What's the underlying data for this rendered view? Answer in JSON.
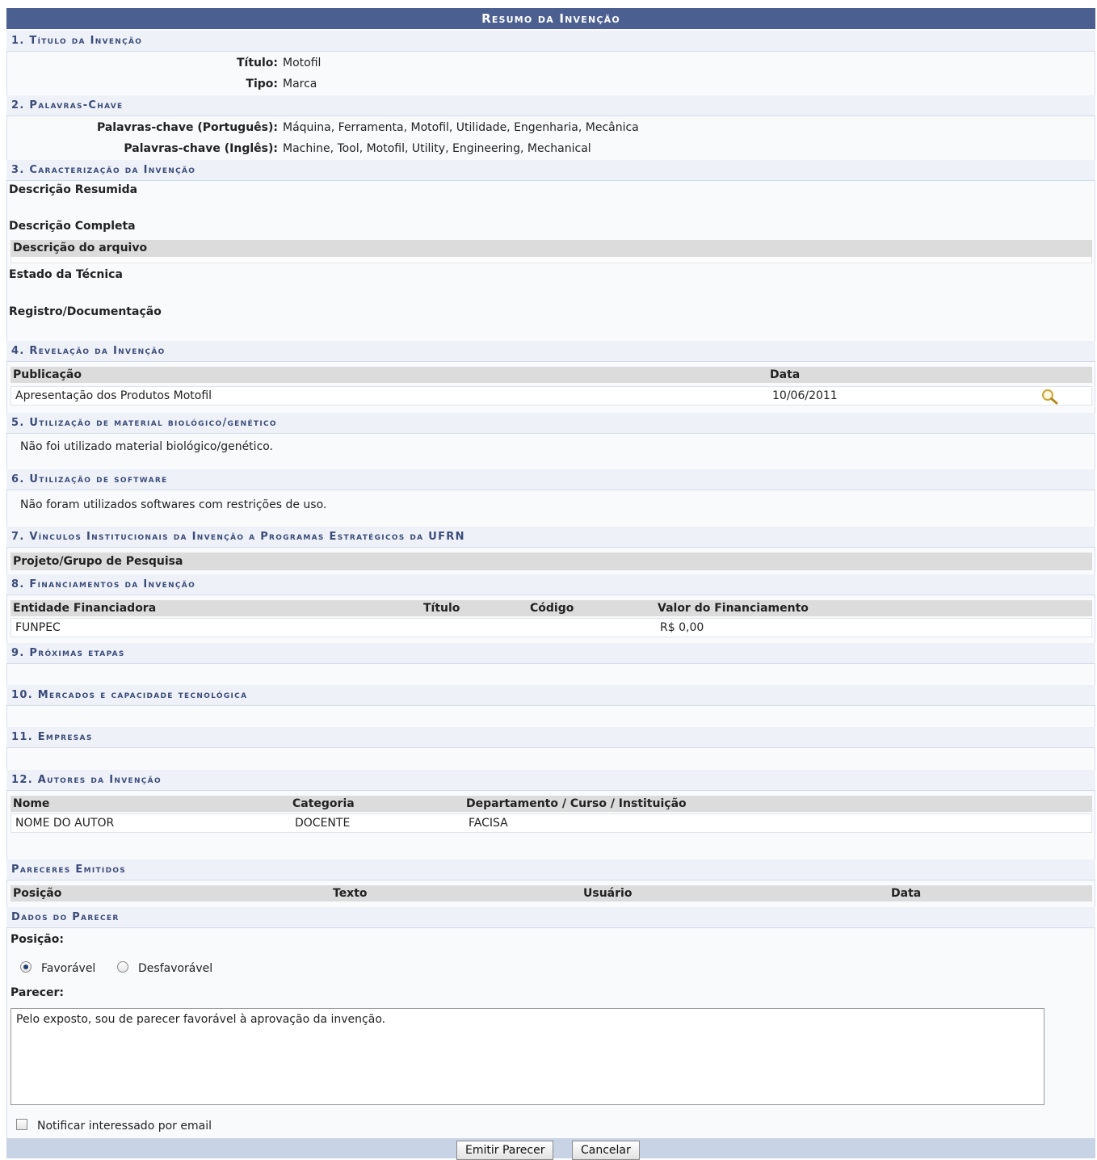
{
  "title": "Resumo da Invenção",
  "s1": {
    "header": "1. Título da Invenção",
    "titulo_label": "Título:",
    "titulo": "Motofil",
    "tipo_label": "Tipo:",
    "tipo": "Marca"
  },
  "s2": {
    "header": "2. Palavras-Chave",
    "pt_label": "Palavras-chave (Português):",
    "pt": "Máquina, Ferramenta, Motofil, Utilidade, Engenharia, Mecânica",
    "en_label": "Palavras-chave (Inglês):",
    "en": "Machine, Tool, Motofil, Utility, Engineering, Mechanical"
  },
  "s3": {
    "header": "3. Caracterização da Invenção",
    "desc_resumida": "Descrição Resumida",
    "desc_completa": "Descrição Completa",
    "desc_arquivo": "Descrição do arquivo",
    "estado_tecnica": "Estado da Técnica",
    "registro": "Registro/Documentação"
  },
  "s4": {
    "header": "4. Revelação da Invenção",
    "columns": [
      "Publicação",
      "Data"
    ],
    "rows": [
      {
        "publicacao": "Apresentação dos Produtos Motofil",
        "data": "10/06/2011",
        "action_icon": "magnifier-icon"
      }
    ]
  },
  "s5": {
    "header": "5. Utilização de material biológico/genético",
    "text": "Não foi utilizado material biológico/genético."
  },
  "s6": {
    "header": "6. Utilização de software",
    "text": "Não foram utilizados softwares com restrições de uso."
  },
  "s7": {
    "header": "7. Vínculos Institucionais da Invenção a Programas Estratégicos da UFRN",
    "subheader": "Projeto/Grupo de Pesquisa"
  },
  "s8": {
    "header": "8. Financiamentos da Invenção",
    "columns": [
      "Entidade Financiadora",
      "Título",
      "Código",
      "Valor do Financiamento"
    ],
    "rows": [
      {
        "entidade": "FUNPEC",
        "titulo": "",
        "codigo": "",
        "valor": "R$ 0,00"
      }
    ]
  },
  "s9": {
    "header": "9. Próximas etapas"
  },
  "s10": {
    "header": "10. Mercados e capacidade tecnológica"
  },
  "s11": {
    "header": "11. Empresas"
  },
  "s12": {
    "header": "12. Autores da Invenção",
    "columns": [
      "Nome",
      "Categoria",
      "Departamento / Curso / Instituição"
    ],
    "rows": [
      {
        "nome": "NOME DO AUTOR",
        "categoria": "DOCENTE",
        "departamento": "FACISA"
      }
    ]
  },
  "pareceres": {
    "header": "Pareceres Emitidos",
    "columns": [
      "Posição",
      "Texto",
      "Usuário",
      "Data"
    ]
  },
  "dados": {
    "header": "Dados do Parecer",
    "posicao_label": "Posição:",
    "options": [
      "Favorável",
      "Desfavorável"
    ],
    "selected": "Favorável",
    "parecer_label": "Parecer:",
    "parecer_value": "Pelo exposto, sou de parecer favorável à aprovação da invenção.",
    "notificar_label": "Notificar interessado por email",
    "notificar_checked": false
  },
  "buttons": {
    "emitir": "Emitir Parecer",
    "cancelar": "Cancelar"
  },
  "colors": {
    "title_bg": "#4b5f91",
    "section_bg": "#eef2f8",
    "section_text": "#3a4b7a",
    "table_header_bg": "#dcdcdc",
    "footer_bg": "#c8d3e6",
    "icon": "#c9a63a"
  }
}
